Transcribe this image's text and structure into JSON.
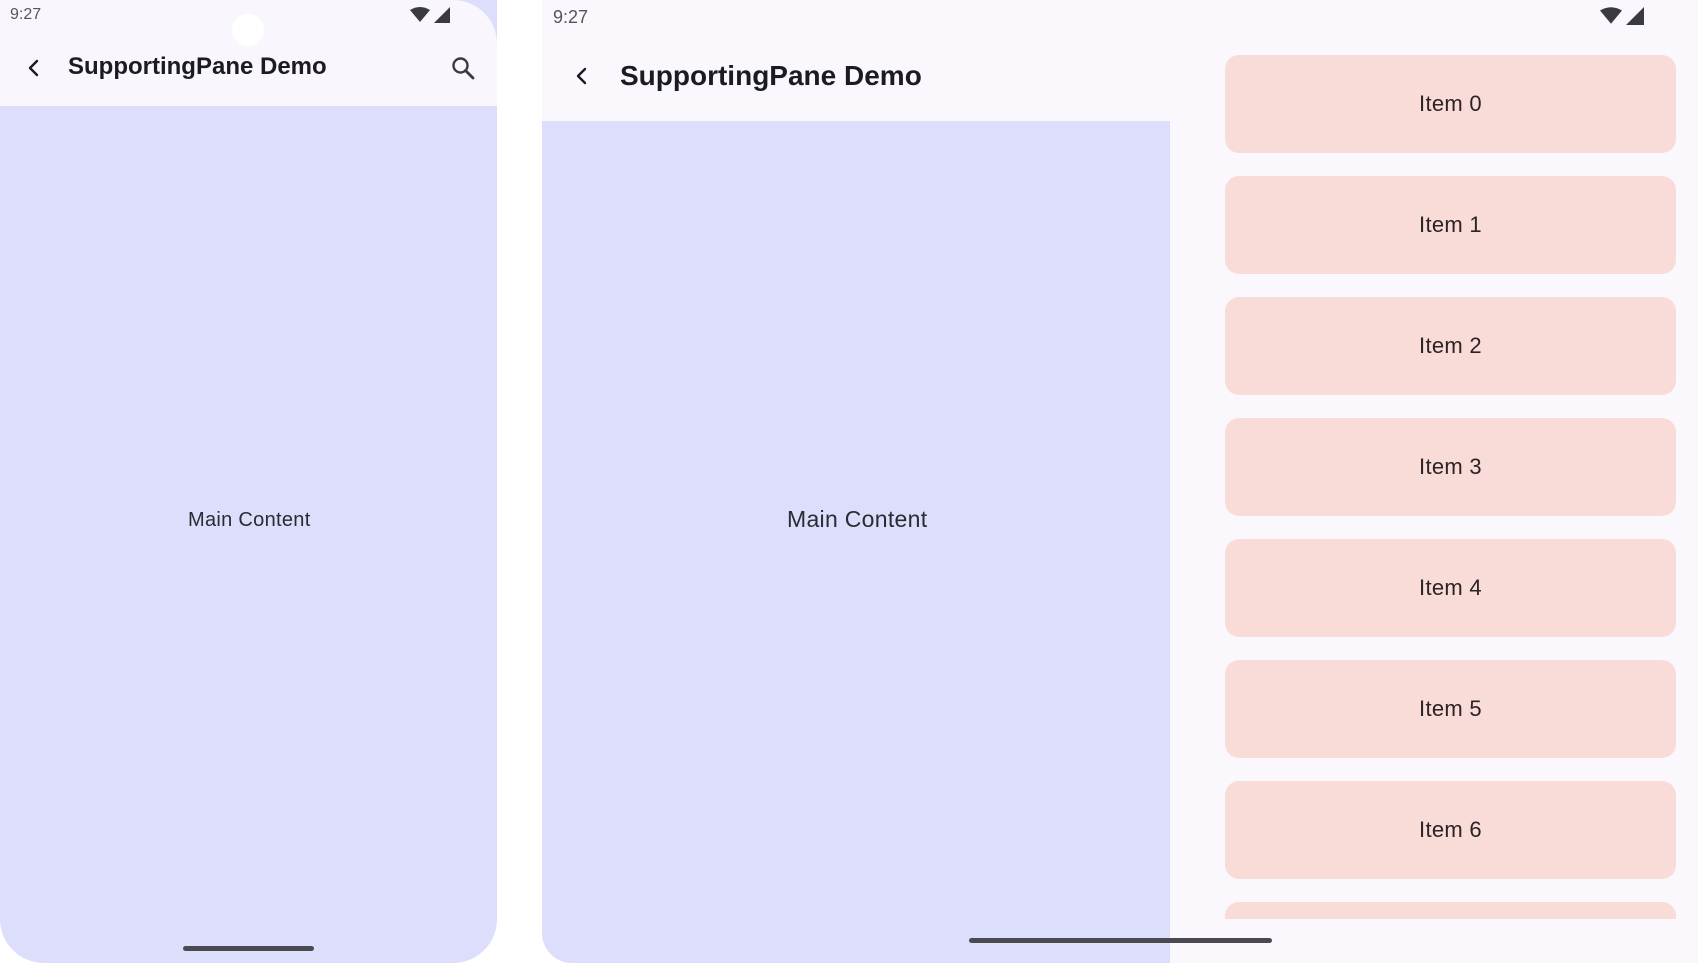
{
  "phone": {
    "status_time": "9:27",
    "title": "SupportingPane Demo",
    "main_content": "Main Content",
    "colors": {
      "main_bg": "#dcdefc",
      "topbar_bg": "#f9f7fd"
    }
  },
  "foldable": {
    "status_time": "9:27",
    "title": "SupportingPane Demo",
    "main_content": "Main Content",
    "items": [
      {
        "label": "Item 0"
      },
      {
        "label": "Item 1"
      },
      {
        "label": "Item 2"
      },
      {
        "label": "Item 3"
      },
      {
        "label": "Item 4"
      },
      {
        "label": "Item 5"
      },
      {
        "label": "Item 6"
      },
      {
        "label": ""
      }
    ],
    "colors": {
      "main_bg": "#dcdefc",
      "item_bg": "#f9dbd8",
      "supporting_bg": "#faf8fd"
    }
  },
  "icons": {
    "back": "back-arrow-icon",
    "search": "search-icon",
    "wifi": "wifi-icon",
    "signal": "cell-signal-icon"
  }
}
